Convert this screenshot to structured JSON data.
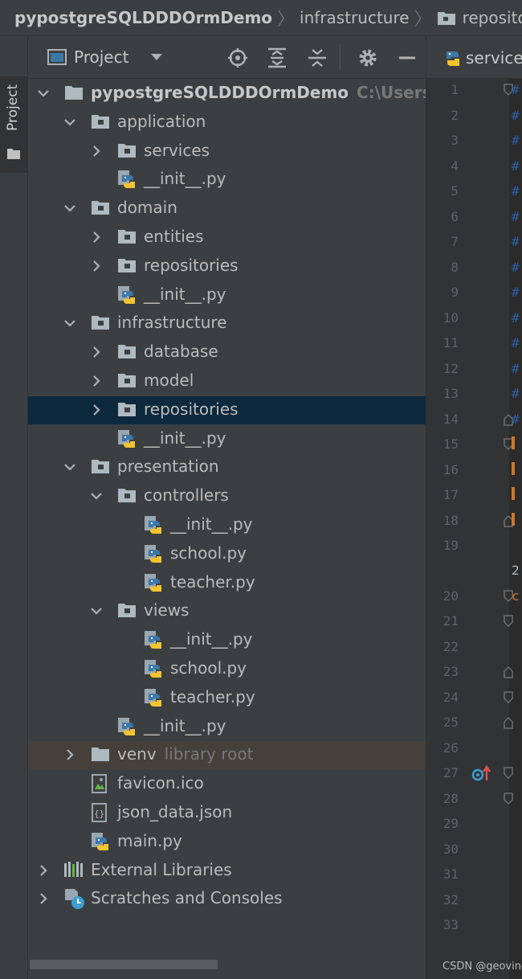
{
  "breadcrumb": {
    "project": "pypostgreSQLDDDOrmDemo",
    "folder1": "infrastructure",
    "folder2": "repositories"
  },
  "tool_window": {
    "side_tab_label": "Project"
  },
  "project_panel": {
    "title": "Project"
  },
  "tree": [
    {
      "label": "pypostgreSQLDDDOrmDemo",
      "hint": "C:\\Users\\ge"
    },
    {
      "label": "application"
    },
    {
      "label": "services"
    },
    {
      "label": "__init__.py"
    },
    {
      "label": "domain"
    },
    {
      "label": "entities"
    },
    {
      "label": "repositories"
    },
    {
      "label": "__init__.py"
    },
    {
      "label": "infrastructure"
    },
    {
      "label": "database"
    },
    {
      "label": "model"
    },
    {
      "label": "repositories"
    },
    {
      "label": "__init__.py"
    },
    {
      "label": "presentation"
    },
    {
      "label": "controllers"
    },
    {
      "label": "__init__.py"
    },
    {
      "label": "school.py"
    },
    {
      "label": "teacher.py"
    },
    {
      "label": "views"
    },
    {
      "label": "__init__.py"
    },
    {
      "label": "school.py"
    },
    {
      "label": "teacher.py"
    },
    {
      "label": "__init__.py"
    },
    {
      "label": "venv",
      "hint": "library root"
    },
    {
      "label": "favicon.ico"
    },
    {
      "label": "json_data.json"
    },
    {
      "label": "main.py"
    },
    {
      "label": "External Libraries"
    },
    {
      "label": "Scratches and Consoles"
    }
  ],
  "editor": {
    "tab_label": "services",
    "line_numbers": [
      "1",
      "2",
      "3",
      "4",
      "5",
      "6",
      "7",
      "8",
      "9",
      "10",
      "11",
      "12",
      "13",
      "14",
      "15",
      "16",
      "17",
      "18",
      "19",
      "20",
      "21",
      "22",
      "23",
      "24",
      "25",
      "26",
      "27",
      "28",
      "29",
      "30",
      "31",
      "32",
      "33"
    ],
    "wrapped_line_text": "2",
    "code_line_20": "c"
  },
  "watermark": "CSDN @geovindu",
  "colors": {
    "background": "#2b2b2b",
    "panel": "#3c3f41",
    "selection": "#0d293e",
    "excluded_folder": "#45403a",
    "folder_icon": "#aeb9c0",
    "python_blue": "#3c78aa",
    "python_yellow": "#f4c430",
    "comment_blue": "#2b5fa8",
    "keyword_orange": "#cc7832"
  }
}
